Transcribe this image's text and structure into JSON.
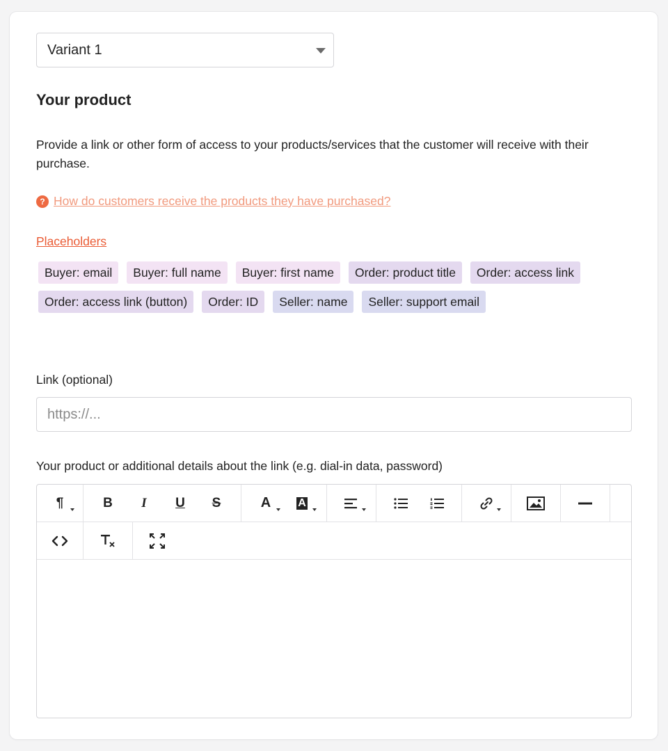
{
  "variant_select": {
    "value": "Variant 1"
  },
  "section": {
    "title": "Your product",
    "description": "Provide a link or other form of access to your products/services that the customer will receive with their purchase.",
    "help_link": "How do customers receive the products they have purchased?",
    "help_icon": "?"
  },
  "placeholders": {
    "link_label": "Placeholders",
    "chips": [
      {
        "label": "Buyer: email",
        "color": "#f3e3f4"
      },
      {
        "label": "Buyer: full name",
        "color": "#f3e3f4"
      },
      {
        "label": "Buyer: first name",
        "color": "#f3e3f4"
      },
      {
        "label": "Order: product title",
        "color": "#e4d9ef"
      },
      {
        "label": "Order: access link",
        "color": "#e4d9ef"
      },
      {
        "label": "Order: access link (button)",
        "color": "#e4d9ef"
      },
      {
        "label": "Order: ID",
        "color": "#e4d9ef"
      },
      {
        "label": "Seller: name",
        "color": "#d9daf0"
      },
      {
        "label": "Seller: support email",
        "color": "#d9daf0"
      }
    ]
  },
  "link_field": {
    "label": "Link (optional)",
    "placeholder": "https://..."
  },
  "details_field": {
    "label": "Your product or additional details about the link (e.g. dial-in data, password)"
  },
  "toolbar": {
    "paragraph_icon": "¶",
    "bold_icon": "B",
    "italic_icon": "I",
    "underline_icon": "U",
    "strikethrough_icon": "S",
    "font_color_icon": "A",
    "highlight_icon": "A"
  },
  "colors": {
    "accent": "#ea5a33",
    "help_link": "#f19a7e"
  }
}
